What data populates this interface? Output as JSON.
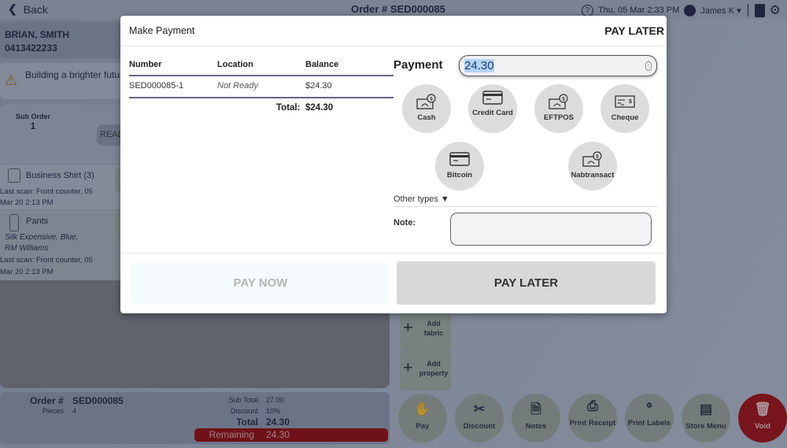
{
  "topbar": {
    "back_label": "Back",
    "order_title": "Order # SED000085",
    "datetime": "Thu, 05 Mar 2:33 PM",
    "user_name": "James K"
  },
  "customer": {
    "name": "BRIAN, SMITH",
    "phone": "0413422233"
  },
  "notice": {
    "text": "Building a brighter future"
  },
  "suborder": {
    "label": "Sub Order",
    "number": "1",
    "status_button": "READY",
    "items": [
      {
        "name": "Business Shirt (3)",
        "desc": "",
        "scan_line1": "Last scan: Front counter, 05",
        "scan_line2": "Mar 20 2:13 PM"
      },
      {
        "name": "Pants",
        "desc_line1": "Silk Expensive, Blue,",
        "desc_line2": "RM Williams",
        "scan_line1": "Last scan: Front counter, 05",
        "scan_line2": "Mar 20 2:13 PM"
      }
    ]
  },
  "summary": {
    "order_label": "Order #",
    "order_value": "SED000085",
    "pieces_label": "Pieces",
    "pieces_value": "4",
    "subtotal_label": "Sub Total",
    "subtotal_value": "27.00",
    "discount_label": "Discount",
    "discount_value": "10%",
    "total_label": "Total",
    "total_value": "24.30",
    "remaining_label": "Remaining",
    "remaining_value": "24.30"
  },
  "side_buttons": {
    "add_fabric": "Add fabric",
    "add_property": "Add property"
  },
  "actions": [
    {
      "label": "Pay",
      "icon": "hand-coins-icon"
    },
    {
      "label": "Discount",
      "icon": "scissors-icon"
    },
    {
      "label": "Notes",
      "icon": "note-pencil-icon"
    },
    {
      "label": "Print Receipt",
      "icon": "printer-icon"
    },
    {
      "label": "Print Labels",
      "icon": "tags-icon"
    },
    {
      "label": "Store Menu",
      "icon": "washing-machine-icon"
    },
    {
      "label": "Void",
      "icon": "trash-icon"
    }
  ],
  "modal": {
    "title": "Make Payment",
    "mode": "PAY LATER",
    "table": {
      "headers": [
        "Number",
        "Location",
        "Balance"
      ],
      "rows": [
        {
          "number": "SED000085-1",
          "location": "Not Ready",
          "balance": "$24.30"
        }
      ],
      "total_label": "Total:",
      "total_value": "$24.30"
    },
    "payment_label": "Payment",
    "payment_value": "24.30",
    "methods": [
      {
        "label": "Cash",
        "icon": "cash-icon"
      },
      {
        "label": "Credit Card",
        "icon": "credit-card-icon"
      },
      {
        "label": "EFTPOS",
        "icon": "cash-icon"
      },
      {
        "label": "Cheque",
        "icon": "cheque-icon"
      },
      {
        "label": "Bitcoin",
        "icon": "credit-card-icon"
      },
      {
        "label": "Nabtransact",
        "icon": "cash-icon"
      }
    ],
    "other_types_label": "Other types",
    "note_label": "Note:",
    "note_value": "",
    "pay_now_label": "PAY NOW",
    "pay_later_label": "PAY LATER"
  }
}
